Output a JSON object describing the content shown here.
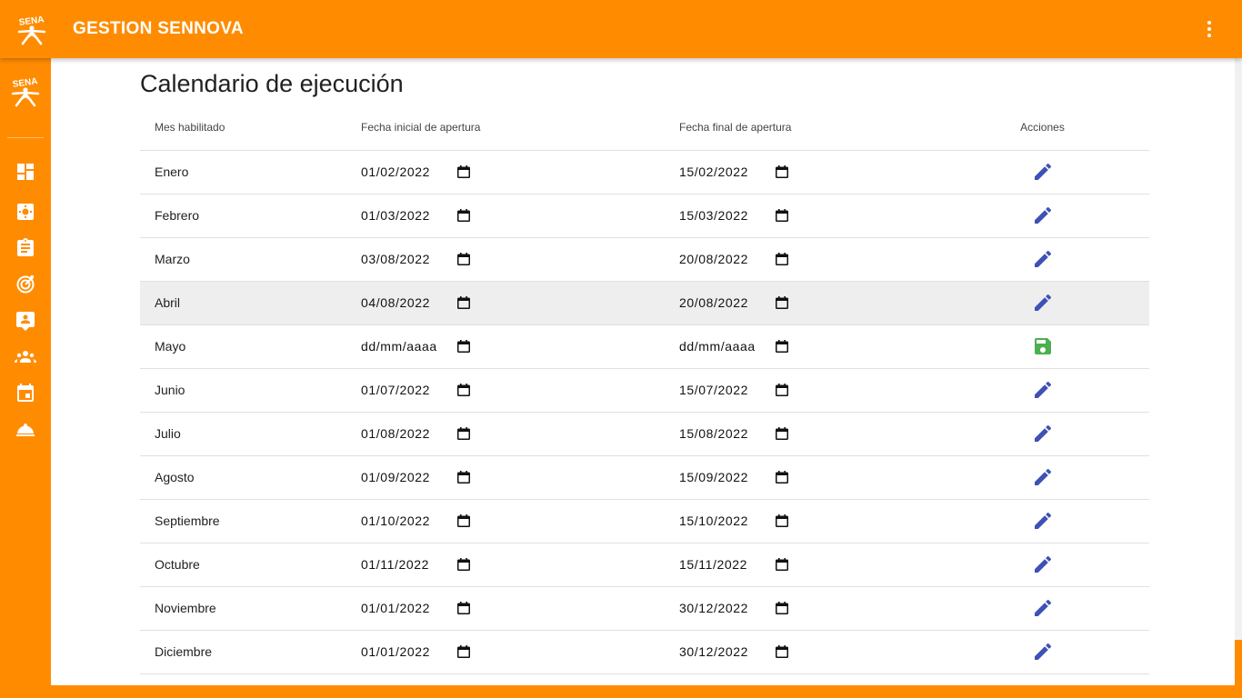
{
  "app": {
    "title": "GESTION SENNOVA"
  },
  "page": {
    "title": "Calendario de ejecución"
  },
  "table": {
    "headers": [
      "Mes habilitado",
      "Fecha inicial de apertura",
      "Fecha final de apertura",
      "Acciones"
    ],
    "rows": [
      {
        "month": "Enero",
        "start": "01/02/2022",
        "end": "15/02/2022",
        "action": "edit-icon"
      },
      {
        "month": "Febrero",
        "start": "01/03/2022",
        "end": "15/03/2022",
        "action": "edit-icon"
      },
      {
        "month": "Marzo",
        "start": "03/08/2022",
        "end": "20/08/2022",
        "action": "edit-icon"
      },
      {
        "month": "Abril",
        "start": "04/08/2022",
        "end": "20/08/2022",
        "action": "edit-icon",
        "highlighted": true
      },
      {
        "month": "Mayo",
        "start": "dd/mm/aaaa",
        "end": "dd/mm/aaaa",
        "action": "save-icon"
      },
      {
        "month": "Junio",
        "start": "01/07/2022",
        "end": "15/07/2022",
        "action": "edit-icon"
      },
      {
        "month": "Julio",
        "start": "01/08/2022",
        "end": "15/08/2022",
        "action": "edit-icon"
      },
      {
        "month": "Agosto",
        "start": "01/09/2022",
        "end": "15/09/2022",
        "action": "edit-icon"
      },
      {
        "month": "Septiembre",
        "start": "01/10/2022",
        "end": "15/10/2022",
        "action": "edit-icon"
      },
      {
        "month": "Octubre",
        "start": "01/11/2022",
        "end": "15/11/2022",
        "action": "edit-icon"
      },
      {
        "month": "Noviembre",
        "start": "01/01/2022",
        "end": "30/12/2022",
        "action": "edit-icon"
      },
      {
        "month": "Diciembre",
        "start": "01/01/2022",
        "end": "30/12/2022",
        "action": "edit-icon"
      }
    ]
  },
  "sidebar": {
    "icons": [
      "dashboard-icon",
      "settings-icon",
      "assignment-icon",
      "target-icon",
      "contact-support-icon",
      "groups-icon",
      "event-icon",
      "room-service-icon"
    ]
  },
  "colors": {
    "brand": "#ff8c00",
    "edit": "#3f51b5",
    "save": "#4caf50",
    "row_highlight": "#eeeeee"
  }
}
